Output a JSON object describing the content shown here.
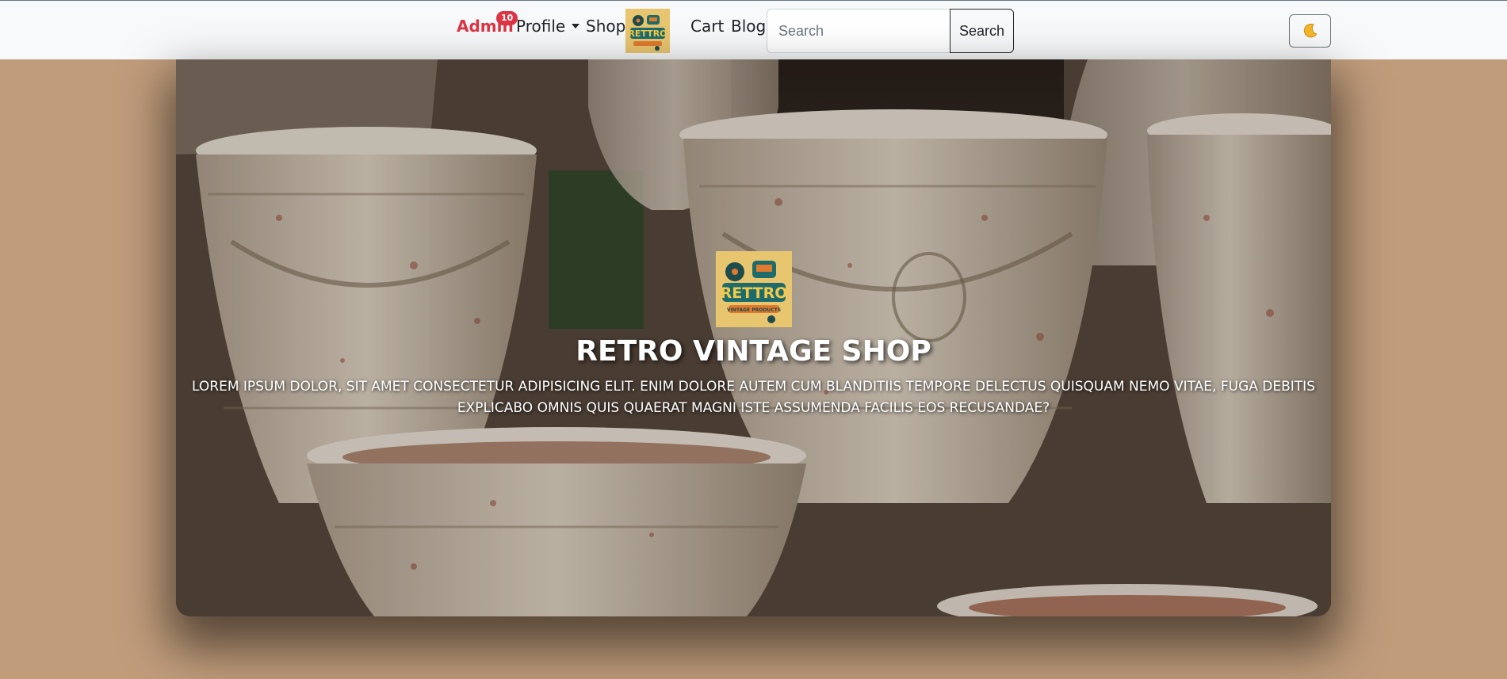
{
  "navbar": {
    "admin_label": "Admin",
    "admin_badge": "10",
    "profile_label": "Profile",
    "shop_label": "Shop",
    "logo_text": "RETTRO",
    "cart_label": "Cart",
    "blog_label": "Blog",
    "search_placeholder": "Search",
    "search_button": "Search",
    "theme_icon": "moon-icon"
  },
  "hero": {
    "logo_text": "RETTRO",
    "logo_subtext": "VINTAGE PRODUCTS",
    "title": "RETRO VINTAGE SHOP",
    "description": "LOREM IPSUM DOLOR, SIT AMET CONSECTETUR ADIPISICING ELIT. ENIM DOLORE AUTEM CUM BLANDITIIS TEMPORE DELECTUS QUISQUAM NEMO VITAE, FUGA DEBITIS EXPLICABO OMNIS QUIS QUAERAT MAGNI ISTE ASSUMENDA FACILIS EOS RECUSANDAE?"
  },
  "colors": {
    "page_background": "#c09c7b",
    "navbar_background": "#f8f9fa",
    "admin_accent": "#dc3545",
    "logo_background": "#e8c56f",
    "logo_text": "#1e6b6b"
  }
}
